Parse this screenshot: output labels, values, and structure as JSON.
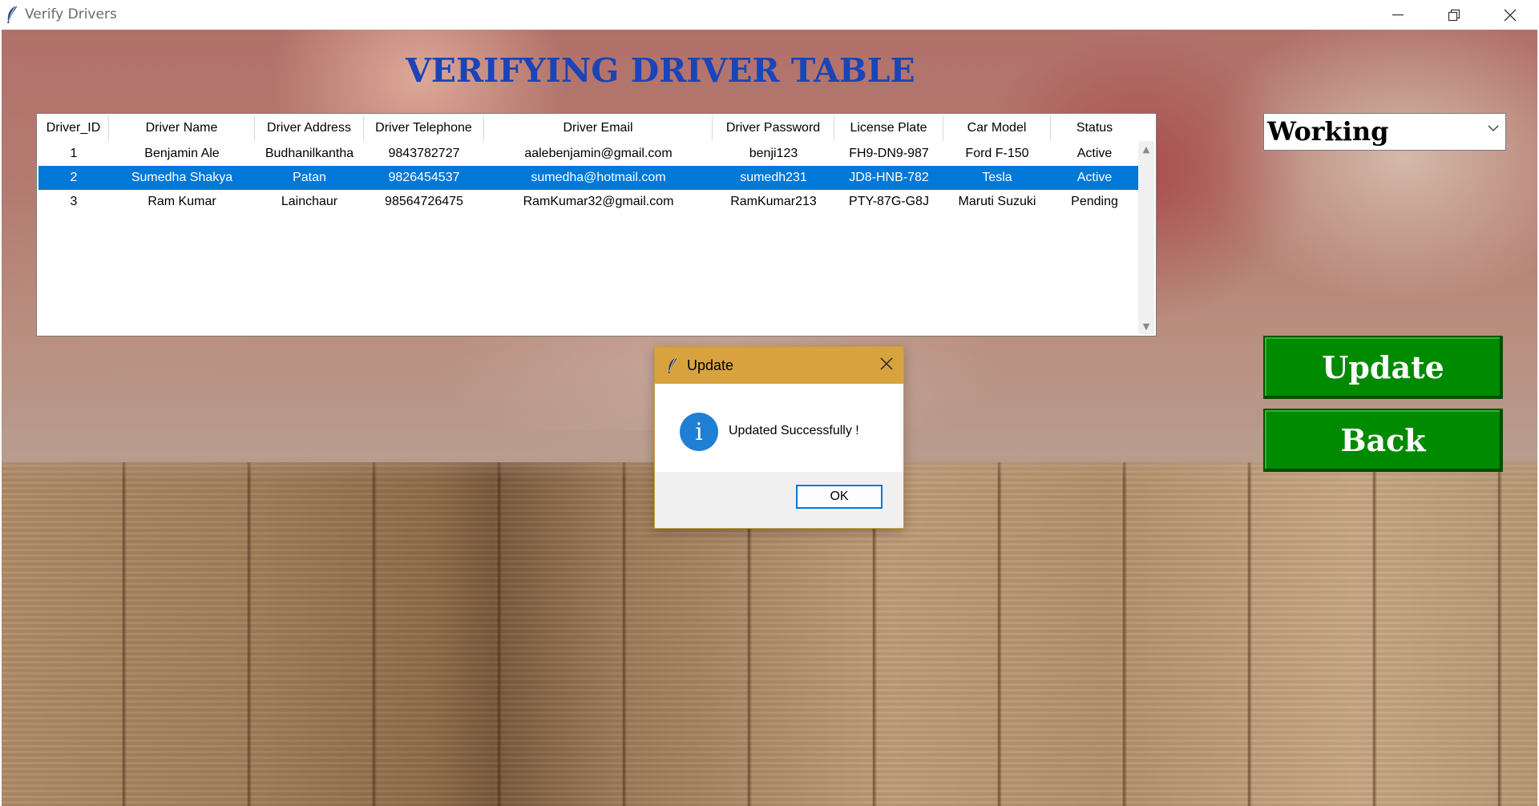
{
  "window": {
    "title": "Verify Drivers"
  },
  "heading": "VERIFYING DRIVER TABLE",
  "table": {
    "columns": [
      "Driver_ID",
      "Driver Name",
      "Driver Address",
      "Driver Telephone",
      "Driver Email",
      "Driver Password",
      "License Plate",
      "Car Model",
      "Status"
    ],
    "rows": [
      [
        "1",
        "Benjamin Ale",
        "Budhanilkantha",
        "9843782727",
        "aalebenjamin@gmail.com",
        "benji123",
        "FH9-DN9-987",
        "Ford F-150",
        "Active"
      ],
      [
        "2",
        "Sumedha Shakya",
        "Patan",
        "9826454537",
        "sumedha@hotmail.com",
        "sumedh231",
        "JD8-HNB-782",
        "Tesla",
        "Active"
      ],
      [
        "3",
        "Ram Kumar",
        "Lainchaur",
        "98564726475",
        "RamKumar32@gmail.com",
        "RamKumar213",
        "PTY-87G-G8J",
        "Maruti Suzuki",
        "Pending"
      ]
    ],
    "selected_row_index": 1
  },
  "status_select": {
    "value": "Working"
  },
  "buttons": {
    "update": "Update",
    "back": "Back"
  },
  "dialog": {
    "title": "Update",
    "message": "Updated Successfully !",
    "ok": "OK",
    "icon": "info-icon"
  },
  "colors": {
    "heading": "#1a44b8",
    "button": "#008a00",
    "selection": "#0078d7",
    "dialog_header": "#d8a33e"
  }
}
